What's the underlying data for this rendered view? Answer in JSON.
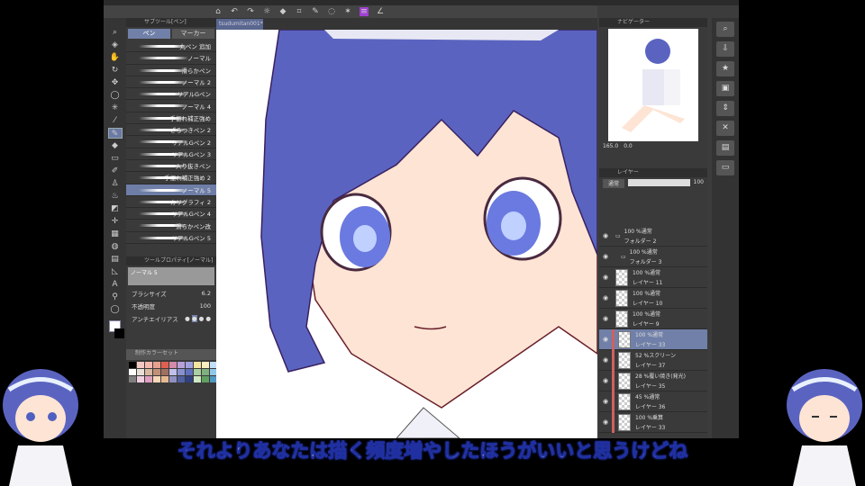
{
  "document_tab": "tsudumitan001*",
  "subtool_panel": {
    "title": "サブツール[ペン]",
    "tabs": [
      "ペン",
      "マーカー"
    ],
    "brushes": [
      "丸ペン 追加",
      "ノーマル",
      "滑らかペン",
      "ノーマル 2",
      "リアルGペン",
      "ノーマル 4",
      "手振れ補正強め",
      "ざらつきペン 2",
      "リアルGペン 2",
      "リアルGペン 3",
      "入り抜きペン",
      "手振れ補正強め 2",
      "ノーマル 5",
      "カリグラフィ 2",
      "リアルGペン 4",
      "滑らかペン改",
      "リアルGペン 5"
    ],
    "selected": "ノーマル 5"
  },
  "tool_property": {
    "title": "ツールプロパティ[ノーマル]",
    "preset": "ノーマル 5",
    "brush_size_label": "ブラシサイズ",
    "brush_size": "6.2",
    "opacity_label": "不透明度",
    "opacity": "100",
    "antialias_label": "アンチエイリアス"
  },
  "color_set": {
    "title": "制作カラーセット",
    "colors": [
      "#000",
      "#f4c9c4",
      "#f6b9b0",
      "#e8a090",
      "#e06050",
      "#d48aa8",
      "#b8a0d8",
      "#a0a0e0",
      "#f4e4a0",
      "#f8f0c0",
      "#c0e0f8",
      "#fff",
      "#e8e0d8",
      "#d8b8a0",
      "#c09078",
      "#a07060",
      "#c0c0e8",
      "#8890d0",
      "#6070c0",
      "#a8d0a0",
      "#80b080",
      "#90c8e8",
      "#808080",
      "#f0d0e0",
      "#e0a0c0",
      "#f8d8b8",
      "#e8b890",
      "#9090c0",
      "#5060a0",
      "#304080",
      "#d0e8c0",
      "#60a060",
      "#5098c0"
    ]
  },
  "navigator": {
    "title": "ナビゲーター",
    "zoom": "165.0",
    "rotation": "0.0"
  },
  "layer_panel": {
    "title": "レイヤー",
    "blend_mode": "通常",
    "opacity": "100",
    "layers": [
      {
        "mode": "100 %通常",
        "name": "フォルダー 2",
        "type": "folder"
      },
      {
        "mode": "100 %通常",
        "name": "フォルダー 3",
        "type": "folder"
      },
      {
        "mode": "100 %通常",
        "name": "レイヤー 11"
      },
      {
        "mode": "100 %通常",
        "name": "レイヤー 10"
      },
      {
        "mode": "100 %通常",
        "name": "レイヤー 9"
      },
      {
        "mode": "100 %通常",
        "name": "レイヤー 33",
        "selected": true
      },
      {
        "mode": "52 %スクリーン",
        "name": "レイヤー 37"
      },
      {
        "mode": "28 %覆い焼き(発光)",
        "name": "レイヤー 35"
      },
      {
        "mode": "45 %通常",
        "name": "レイヤー 36"
      },
      {
        "mode": "100 %乗算",
        "name": "レイヤー 33"
      }
    ]
  },
  "subtitle": "それよりあなたは描く頻度増やしたほうがいいと思うけどね",
  "colors": {
    "accent": "#7180a8",
    "hair": "#5a64c0",
    "skin": "#fde4d4"
  }
}
